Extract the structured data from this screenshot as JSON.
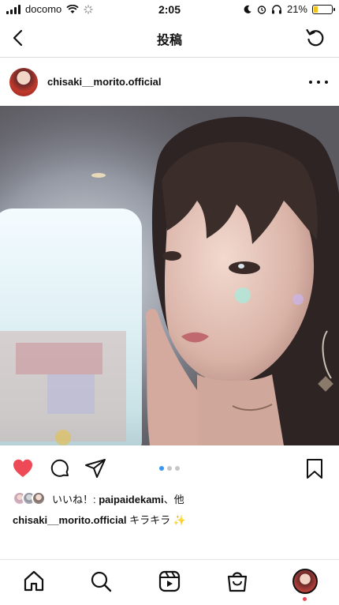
{
  "status_bar": {
    "carrier": "docomo",
    "time": "2:05",
    "battery": "21%",
    "battery_level": 0.21
  },
  "header": {
    "title": "投稿"
  },
  "post": {
    "username": "chisaki__morito.official",
    "carousel": {
      "count": 3,
      "active_index": 0
    },
    "liked": true,
    "likes_prefix": "いいね！: ",
    "likes_user": "paipaidekami",
    "likes_suffix": "、他",
    "caption_user": "chisaki__morito.official",
    "caption_text": "キラキラ",
    "caption_emoji": "✨"
  },
  "colors": {
    "like_red": "#ed4956",
    "carousel_active": "#3897f0",
    "notification_dot": "#ed4956"
  },
  "icons": {
    "back": "chevron-left-icon",
    "refresh": "refresh-icon",
    "more": "more-horizontal-icon",
    "like": "heart-filled-icon",
    "comment": "comment-icon",
    "share": "send-icon",
    "save": "bookmark-icon",
    "tabs": [
      "home-icon",
      "search-icon",
      "reels-icon",
      "shop-icon",
      "profile-avatar"
    ]
  }
}
